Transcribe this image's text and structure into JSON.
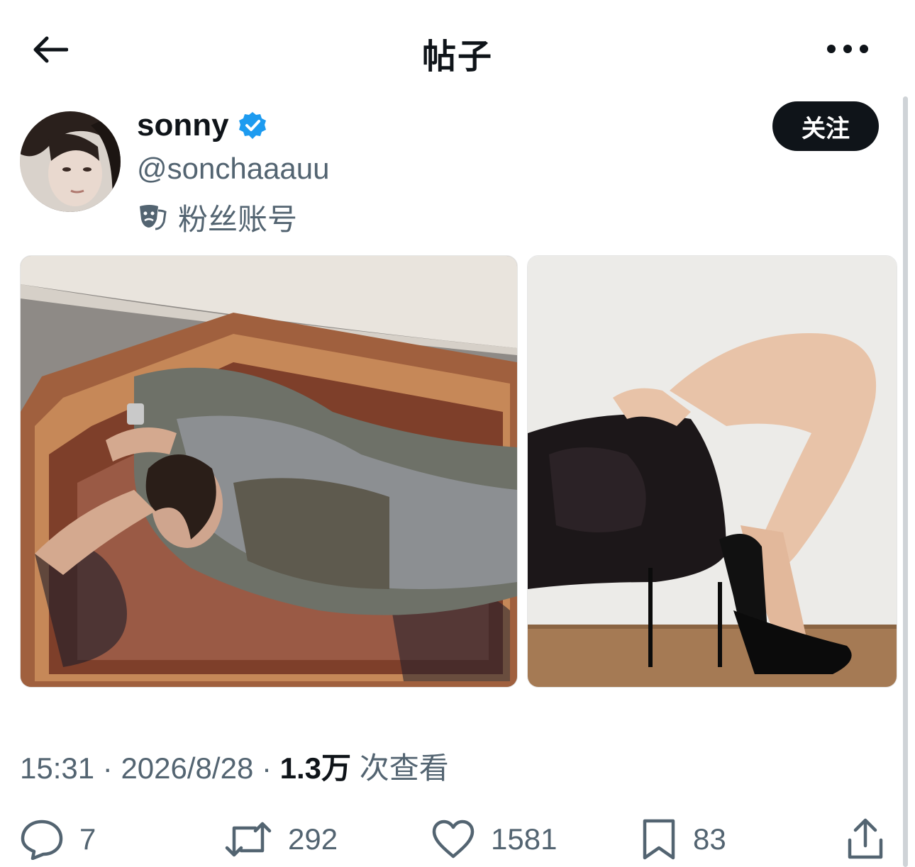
{
  "header": {
    "title": "帖子",
    "back_icon": "arrow-left-icon",
    "more_icon": "more-horizontal-icon"
  },
  "author": {
    "name": "sonny",
    "handle": "@sonchaaauu",
    "account_type_label": "粉丝账号",
    "verified": true,
    "verified_color": "#1d9bf0",
    "follow_label": "关注"
  },
  "post": {
    "media": [
      {
        "label": "photo-man-on-rug"
      },
      {
        "label": "photo-lace-and-heels"
      }
    ],
    "time": "15:31",
    "date": "2026/8/28",
    "views_count": "1.3万",
    "views_label": "次查看",
    "separator": "·"
  },
  "actions": {
    "replies": "7",
    "retweets": "292",
    "likes": "1581",
    "bookmarks": "83"
  },
  "colors": {
    "text_primary": "#0f1419",
    "text_secondary": "#536471",
    "button_bg": "#0f1419"
  }
}
